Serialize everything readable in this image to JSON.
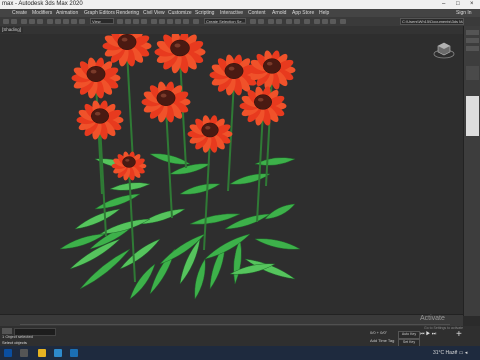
{
  "window": {
    "title": "max - Autodesk 3ds Max 2020"
  },
  "menus": [
    "Create",
    "Modifiers",
    "Animation",
    "Graph Editors",
    "Rendering",
    "Civil View",
    "Customize",
    "Scripting",
    "Interactive",
    "Content",
    "Arnold",
    "App Store",
    "Help"
  ],
  "sign_in": "Sign In",
  "toolbar": {
    "view_dropdown": "View",
    "selection_set": "Create Selection Se...",
    "path": "C:\\Users\\Wh15\\Documents\\3ds Max 2020"
  },
  "viewport": {
    "label": "[Shading]"
  },
  "status": {
    "selection_message": "1 Object selected",
    "prompt": "Select objects",
    "add_time_tag": "Add Time Tag",
    "coordinate_readout": "0/0 + 0/0\"",
    "auto_key": "Auto Key",
    "set_key": "Set Key"
  },
  "activation": {
    "title": "Activate",
    "subtitle": "Go to Settings to activate"
  },
  "taskbar": {
    "weather": "31°C Haze"
  },
  "colors": {
    "leaf": "#3db14a",
    "petal": "#e83a1e",
    "center": "#4a1a12",
    "stem": "#2f7a35",
    "viewport_bg": "#2e2e2e"
  }
}
